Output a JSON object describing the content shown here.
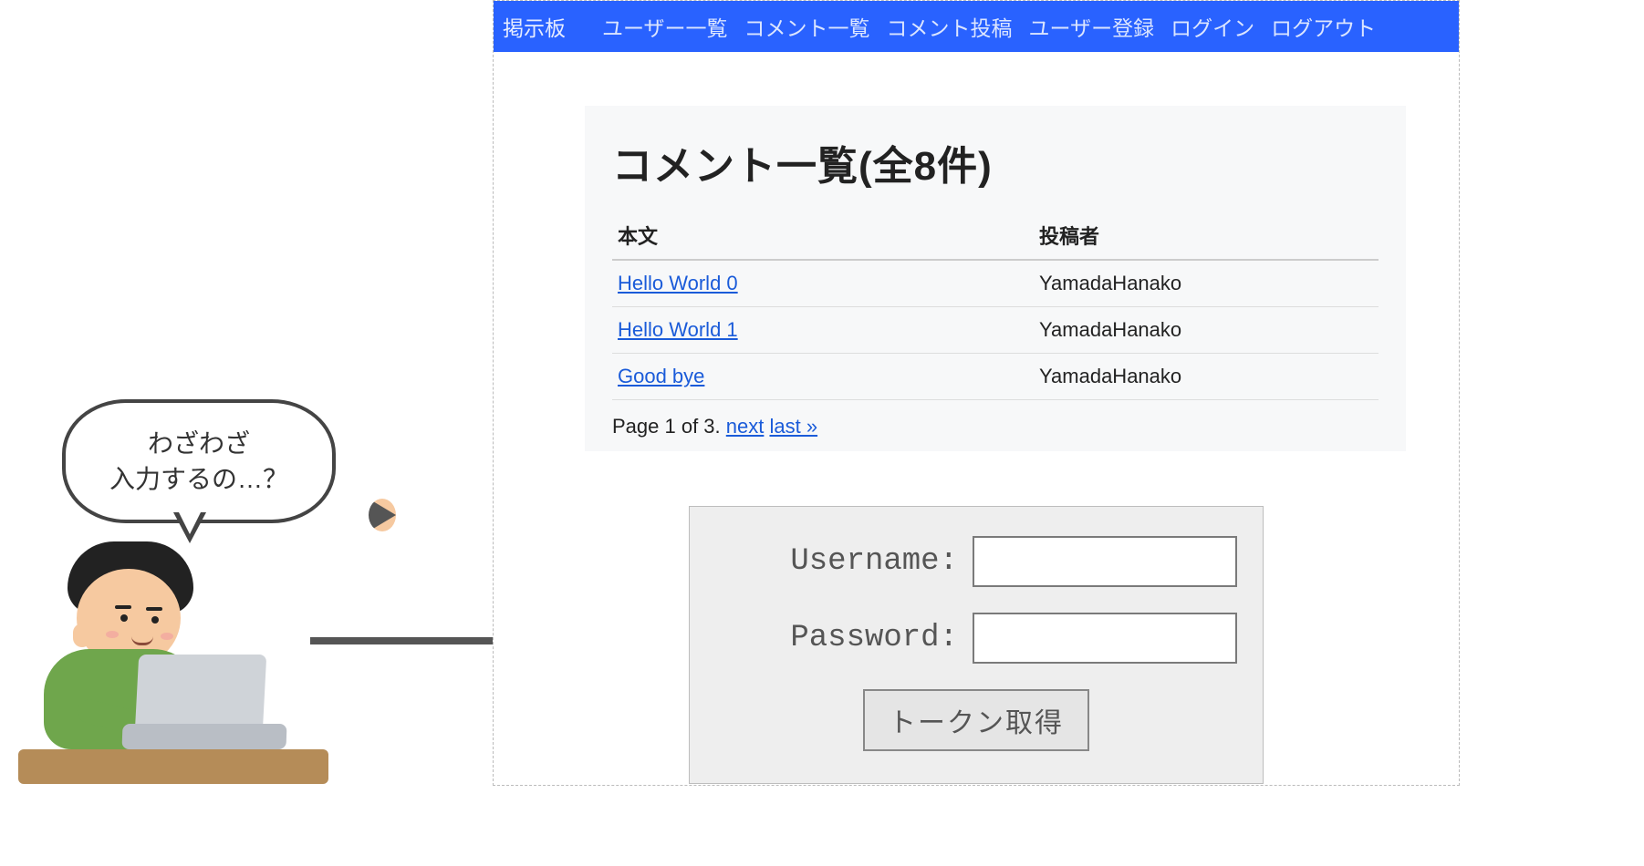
{
  "nav": {
    "brand": "掲示板",
    "items": [
      "ユーザー一覧",
      "コメント一覧",
      "コメント投稿",
      "ユーザー登録",
      "ログイン",
      "ログアウト"
    ]
  },
  "page": {
    "heading_prefix": "コメント一覧(全",
    "heading_count": "8",
    "heading_suffix": "件)"
  },
  "table": {
    "headers": {
      "body": "本文",
      "author": "投稿者"
    },
    "rows": [
      {
        "body": "Hello World 0",
        "author": "YamadaHanako"
      },
      {
        "body": "Hello World 1",
        "author": "YamadaHanako"
      },
      {
        "body": "Good bye",
        "author": "YamadaHanako"
      }
    ]
  },
  "pager": {
    "text": "Page 1 of 3. ",
    "next": "next",
    "last": "last »"
  },
  "login": {
    "username_label": "Username:",
    "password_label": "Password:",
    "button": "トークン取得"
  },
  "speech": {
    "line1": "わざわざ",
    "line2": "入力するの…？"
  }
}
